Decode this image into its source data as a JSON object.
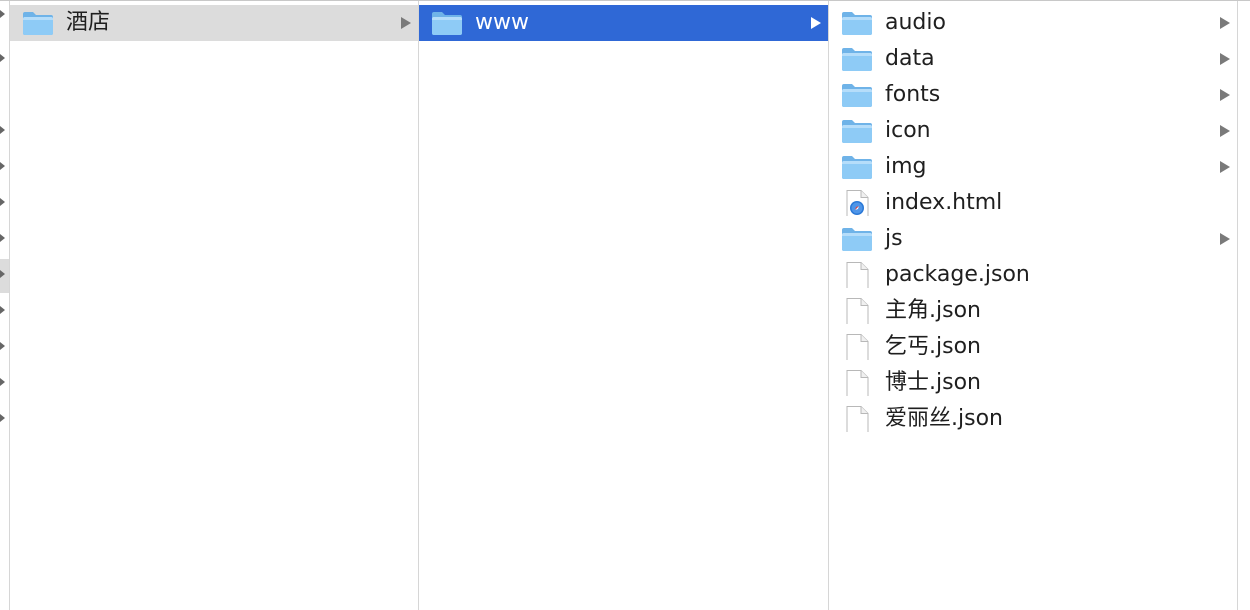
{
  "columns": [
    {
      "items": [
        {
          "name": "酒店",
          "kind": "folder",
          "has_children": true,
          "state": "parent"
        }
      ]
    },
    {
      "items": [
        {
          "name": "www",
          "kind": "folder",
          "has_children": true,
          "state": "selected"
        }
      ]
    },
    {
      "items": [
        {
          "name": "audio",
          "kind": "folder",
          "has_children": true
        },
        {
          "name": "data",
          "kind": "folder",
          "has_children": true
        },
        {
          "name": "fonts",
          "kind": "folder",
          "has_children": true
        },
        {
          "name": "icon",
          "kind": "folder",
          "has_children": true
        },
        {
          "name": "img",
          "kind": "folder",
          "has_children": true
        },
        {
          "name": "index.html",
          "kind": "html",
          "has_children": false
        },
        {
          "name": "js",
          "kind": "folder",
          "has_children": true
        },
        {
          "name": "package.json",
          "kind": "file",
          "has_children": false
        },
        {
          "name": "主角.json",
          "kind": "file",
          "has_children": false
        },
        {
          "name": "乞丐.json",
          "kind": "file",
          "has_children": false
        },
        {
          "name": "博士.json",
          "kind": "file",
          "has_children": false
        },
        {
          "name": "爱丽丝.json",
          "kind": "file",
          "has_children": false
        }
      ]
    }
  ],
  "colors": {
    "selection": "#2f68d6",
    "parent_highlight": "#dcdcdc",
    "folder_blue": "#8ecbf6"
  },
  "icons": {
    "folder": "folder-icon",
    "html": "html-document-icon",
    "file": "generic-document-icon",
    "disclosure": "disclosure-triangle-icon"
  }
}
